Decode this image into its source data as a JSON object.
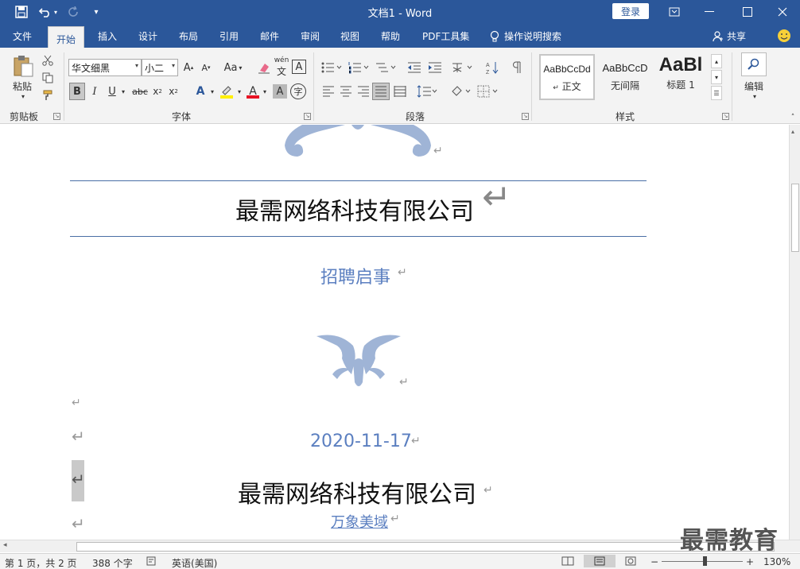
{
  "window": {
    "title": "文档1 - Word",
    "login": "登录"
  },
  "tabs": [
    {
      "label": "文件"
    },
    {
      "label": "开始"
    },
    {
      "label": "插入"
    },
    {
      "label": "设计"
    },
    {
      "label": "布局"
    },
    {
      "label": "引用"
    },
    {
      "label": "邮件"
    },
    {
      "label": "审阅"
    },
    {
      "label": "视图"
    },
    {
      "label": "帮助"
    },
    {
      "label": "PDF工具集"
    }
  ],
  "tellme": "操作说明搜索",
  "share": "共享",
  "ribbon": {
    "clipboard": {
      "paste": "粘贴",
      "label": "剪贴板"
    },
    "font": {
      "name": "华文细黑",
      "size": "小二",
      "label": "字体",
      "case_btn": "Aa",
      "grow": "A",
      "shrink": "A",
      "wen": "wén",
      "bold": "B",
      "italic": "I",
      "underline": "U",
      "strike": "abc",
      "sub": "x",
      "sup": "x",
      "sub_mark": "2",
      "sup_mark": "2",
      "font_color": "A",
      "shading": "A",
      "enclose": "字"
    },
    "paragraph": {
      "label": "段落"
    },
    "styles": {
      "label": "样式",
      "items": [
        {
          "preview": "AaBbCcDd",
          "name": "正文"
        },
        {
          "preview": "AaBbCcD",
          "name": "无间隔"
        },
        {
          "preview": "AaBl",
          "name": "标题 1"
        }
      ]
    },
    "editing": {
      "label": "编辑"
    }
  },
  "document": {
    "company_top": "最需网络科技有限公司",
    "recruit": "招聘启事",
    "date": "2020-11-17",
    "company_bottom": "最需网络科技有限公司",
    "author": "万象美域"
  },
  "status": {
    "page": "第 1 页，共 2 页",
    "words": "388 个字",
    "language": "英语(美国)",
    "zoom": "130%",
    "zoom_minus": "−",
    "zoom_plus": "+"
  },
  "watermark": "最需教育",
  "colors": {
    "accent": "#2b579a",
    "doc_blue": "#5b7fc0",
    "ornament": "#9fb4d6"
  }
}
